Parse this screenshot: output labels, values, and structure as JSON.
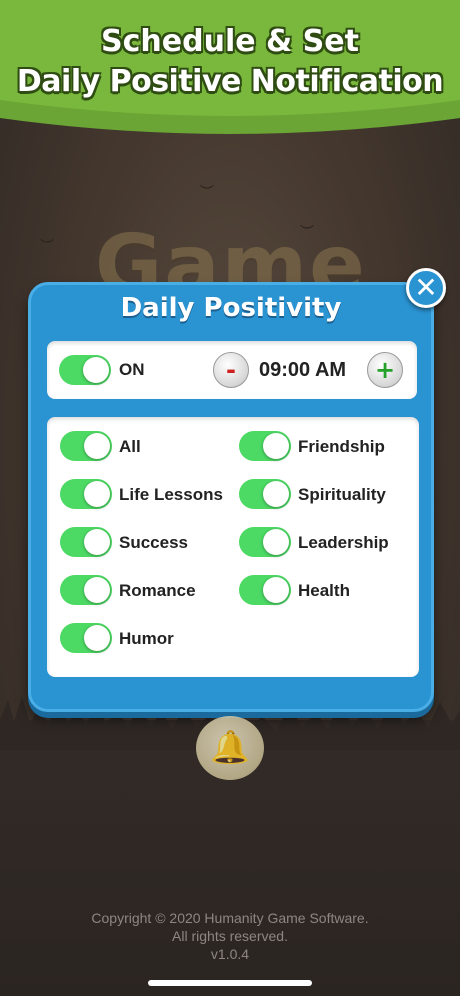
{
  "banner": {
    "line1": "Schedule & Set",
    "line2": "Daily Positive Notification"
  },
  "background": {
    "logo_text": "Game"
  },
  "dialog": {
    "title": "Daily Positivity",
    "close_icon": "close-icon",
    "master_toggle": {
      "label": "ON",
      "state": "on"
    },
    "time": {
      "value": "09:00 AM",
      "minus": "-",
      "plus": "+"
    },
    "categories": [
      {
        "label": "All",
        "state": "on"
      },
      {
        "label": "Friendship",
        "state": "on"
      },
      {
        "label": "Life Lessons",
        "state": "on"
      },
      {
        "label": "Spirituality",
        "state": "on"
      },
      {
        "label": "Success",
        "state": "on"
      },
      {
        "label": "Leadership",
        "state": "on"
      },
      {
        "label": "Romance",
        "state": "on"
      },
      {
        "label": "Health",
        "state": "on"
      },
      {
        "label": "Humor",
        "state": "on"
      }
    ]
  },
  "bell_icon": "bell-icon",
  "footer": {
    "copyright": "Copyright © 2020 Humanity Game Software.",
    "rights": "All rights reserved.",
    "version": "v1.0.4"
  },
  "colors": {
    "accent_blue": "#2a93d2",
    "toggle_green": "#4cd964",
    "banner_green": "#6aa535"
  }
}
